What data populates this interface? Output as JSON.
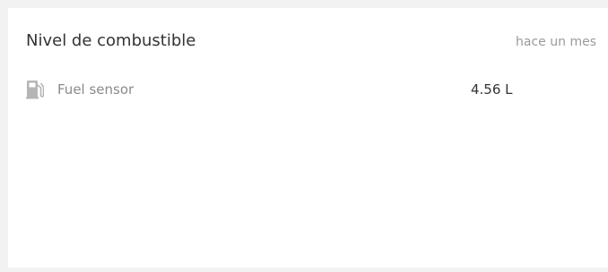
{
  "widget": {
    "title": "Nivel de combustible",
    "timestamp": "hace un mes",
    "sensors": [
      {
        "icon": "fuel-pump-icon",
        "name": "Fuel sensor",
        "value": "4.56 L"
      }
    ]
  },
  "colors": {
    "background": "#f2f2f2",
    "card": "#ffffff",
    "title_text": "#333333",
    "muted_text": "#9a9a9a",
    "icon": "#b5b5b5"
  }
}
